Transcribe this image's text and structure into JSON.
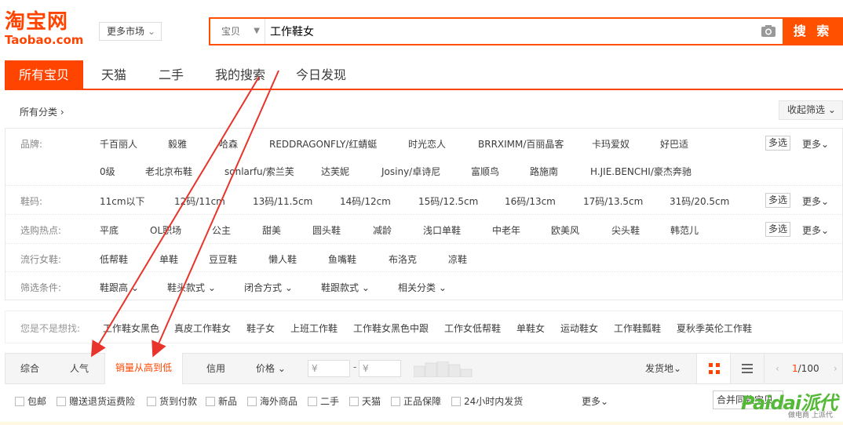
{
  "logo": {
    "cn": "淘宝网",
    "en": "Taobao.com"
  },
  "market_select": "更多市场",
  "search": {
    "type": "宝贝",
    "query": "工作鞋女",
    "button": "搜 索"
  },
  "nav_tabs": [
    "所有宝贝",
    "天猫",
    "二手",
    "我的搜索",
    "今日发现"
  ],
  "category": {
    "label": "所有分类",
    "collapse": "收起筛选"
  },
  "filters": {
    "brand": {
      "label": "品牌:",
      "row1": [
        "千百丽人",
        "毅雅",
        "哈森",
        "REDDRAGONFLY/红蜻蜓",
        "时光恋人",
        "BRRXIMM/百丽晶客",
        "卡玛爱奴",
        "好巴适"
      ],
      "row2": [
        "0级",
        "老北京布鞋",
        "sonlarfu/索兰芙",
        "达芙妮",
        "Josiny/卓诗尼",
        "富顺鸟",
        "路施南",
        "H.JIE.BENCHI/豪杰奔驰"
      ]
    },
    "size": {
      "label": "鞋码:",
      "items": [
        "11cm以下",
        "12码/11cm",
        "13码/11.5cm",
        "14码/12cm",
        "15码/12.5cm",
        "16码/13cm",
        "17码/13.5cm",
        "31码/20.5cm"
      ]
    },
    "hot": {
      "label": "选购热点:",
      "items": [
        "平底",
        "OL职场",
        "公主",
        "甜美",
        "圆头鞋",
        "减龄",
        "浅口单鞋",
        "中老年",
        "欧美风",
        "尖头鞋",
        "韩范儿"
      ]
    },
    "trend": {
      "label": "流行女鞋:",
      "items": [
        "低帮鞋",
        "单鞋",
        "豆豆鞋",
        "懒人鞋",
        "鱼嘴鞋",
        "布洛克",
        "凉鞋"
      ]
    },
    "conditions": {
      "label": "筛选条件:",
      "items": [
        "鞋跟高",
        "鞋头款式",
        "闭合方式",
        "鞋跟款式",
        "相关分类"
      ]
    },
    "multi_label": "多选",
    "more_label": "更多"
  },
  "suggest": {
    "label": "您是不是想找:",
    "items": [
      "工作鞋女黑色",
      "真皮工作鞋女",
      "鞋子女",
      "上班工作鞋",
      "工作鞋女黑色中跟",
      "工作女低帮鞋",
      "单鞋女",
      "运动鞋女",
      "工作鞋瓢鞋",
      "夏秋季英伦工作鞋"
    ]
  },
  "sort": {
    "tabs": [
      "综合",
      "人气",
      "销量从高到低",
      "信用",
      "价格"
    ],
    "price_min": "¥",
    "price_max": "¥",
    "dash": "-",
    "ship_from": "发货地",
    "pager": {
      "current": "1",
      "total": "/100"
    }
  },
  "checks": [
    "包邮",
    "赠送退货运费险",
    "货到付款",
    "新品",
    "海外商品",
    "二手",
    "天猫",
    "正品保障",
    "24小时内发货"
  ],
  "more2": "更多",
  "merge": "合并同款宝贝",
  "watermark": {
    "main": "Paidai派代",
    "sub": "做电商 上派代"
  },
  "colors": {
    "accent": "#ff4400",
    "watermark": "#55b938",
    "annotation_arrow": "#e8342b"
  }
}
